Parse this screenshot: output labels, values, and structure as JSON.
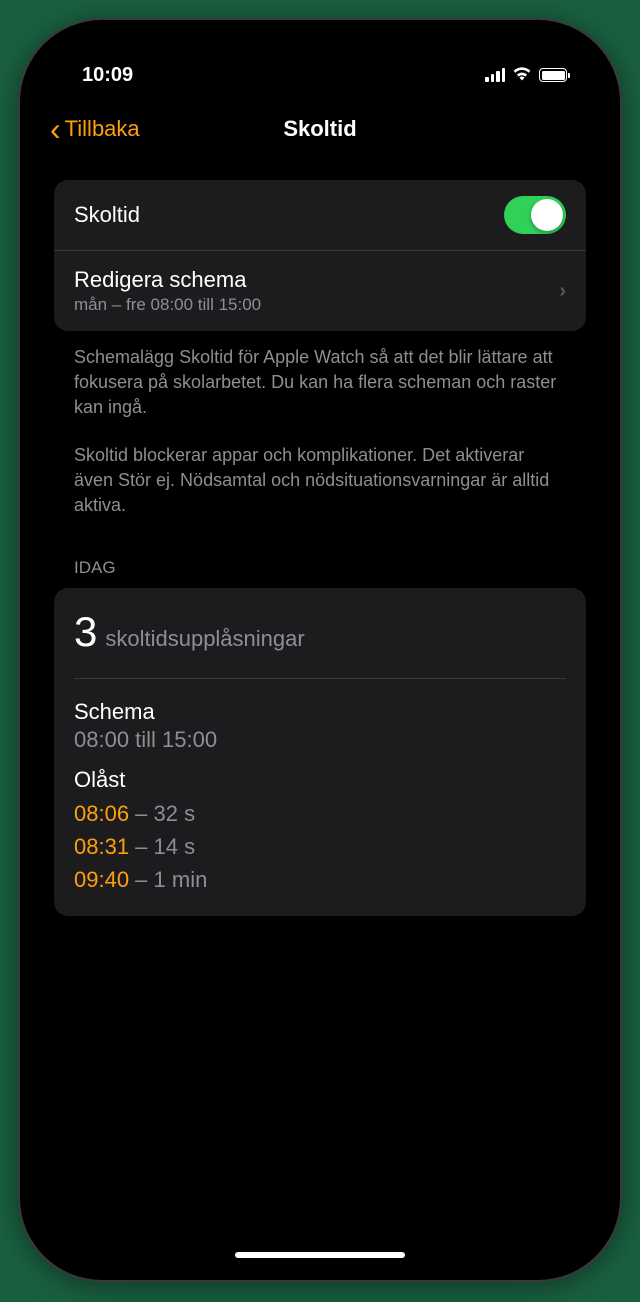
{
  "statusBar": {
    "time": "10:09"
  },
  "nav": {
    "backLabel": "Tillbaka",
    "title": "Skoltid"
  },
  "settings": {
    "skoltidLabel": "Skoltid",
    "editScheduleLabel": "Redigera schema",
    "scheduleSummary": "mån – fre 08:00 till 15:00"
  },
  "description": {
    "paragraph1": "Schemalägg Skoltid för Apple Watch så att det blir lättare att fokusera på skolarbetet. Du kan ha flera scheman och raster kan ingå.",
    "paragraph2": "Skoltid blockerar appar och komplikationer. Det aktiverar även Stör ej. Nödsamtal och nödsituationsvarningar är alltid aktiva."
  },
  "today": {
    "header": "IDAG",
    "unlockCount": "3",
    "unlockCountLabel": "skoltidsupplåsningar",
    "scheduleTitle": "Schema",
    "scheduleTime": "08:00 till 15:00",
    "unlockedTitle": "Olåst",
    "unlocks": [
      {
        "time": "08:06",
        "duration": " – 32 s"
      },
      {
        "time": "08:31",
        "duration": " – 14 s"
      },
      {
        "time": "09:40",
        "duration": " – 1 min"
      }
    ]
  }
}
